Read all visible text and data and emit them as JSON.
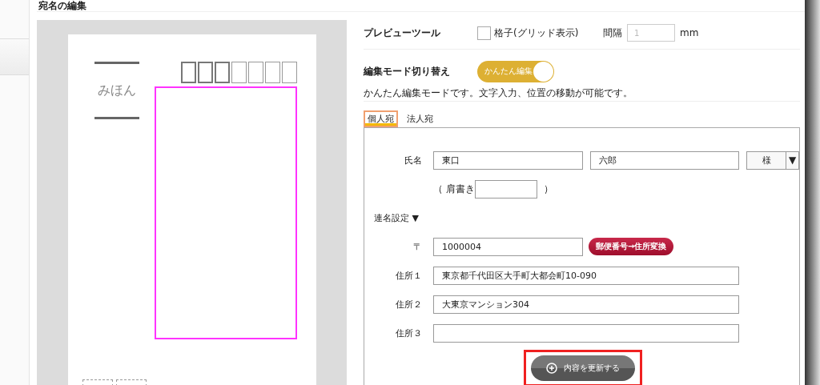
{
  "dialog": {
    "title": "宛名の編集"
  },
  "preview": {
    "sample_label": "みほん"
  },
  "preview_tool": {
    "label": "プレビューツール",
    "grid": {
      "label": "格子(グリッド表示)",
      "checked": false
    },
    "spacing_label": "間隔",
    "spacing": {
      "placeholder": "1"
    },
    "unit": "mm"
  },
  "edit_mode": {
    "label": "編集モード切り替え",
    "toggle": {
      "label": "かんたん編集",
      "on": true
    },
    "description": "かんたん編集モードです。文字入力、位置の移動が可能です。"
  },
  "tabs": [
    {
      "label": "個人宛",
      "selected": true
    },
    {
      "label": "法人宛",
      "selected": false
    }
  ],
  "form": {
    "name_label": "氏名",
    "last_name": "東口",
    "first_name": "六郎",
    "honorific": "様",
    "honorific_arrow": "▼",
    "title_open": "（ 肩書き",
    "title_close": "）",
    "joint_toggle": "連名設定 ▼",
    "postal_label": "〒",
    "postal_code": "1000004",
    "convert_button": "郵便番号→住所変換",
    "addresses": [
      {
        "label": "住所１",
        "value": "東京都千代田区大手町大都会町10-090"
      },
      {
        "label": "住所２",
        "value": "大東京マンション304"
      },
      {
        "label": "住所３"
      }
    ],
    "update_button": "内容を更新する",
    "update_highlighted": true
  }
}
